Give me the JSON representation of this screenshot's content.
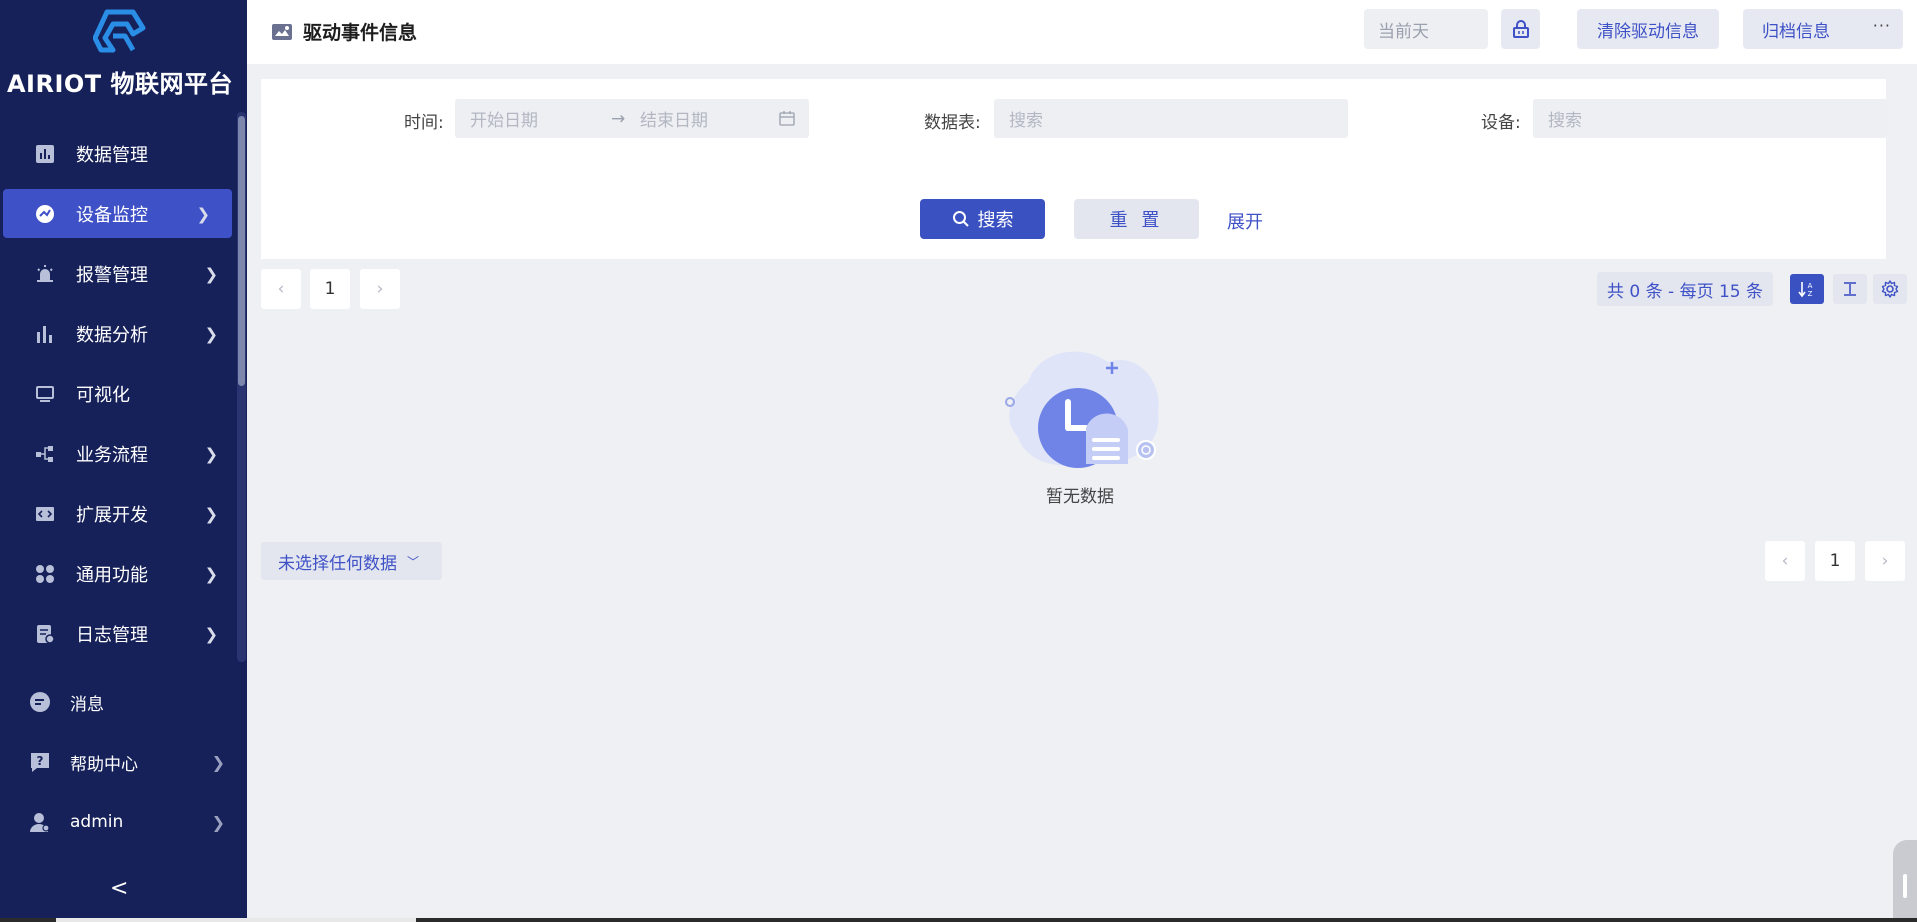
{
  "brand": {
    "name": "AIRIOT 物联网平台"
  },
  "sidebar": {
    "items": [
      {
        "label": "数据管理",
        "icon": "data-management-icon",
        "has_children": false
      },
      {
        "label": "设备监控",
        "icon": "device-monitor-icon",
        "has_children": true,
        "active": true
      },
      {
        "label": "报警管理",
        "icon": "alarm-icon",
        "has_children": true
      },
      {
        "label": "数据分析",
        "icon": "bar-chart-icon",
        "has_children": true
      },
      {
        "label": "可视化",
        "icon": "monitor-icon",
        "has_children": false
      },
      {
        "label": "业务流程",
        "icon": "flow-icon",
        "has_children": true
      },
      {
        "label": "扩展开发",
        "icon": "code-icon",
        "has_children": true
      },
      {
        "label": "通用功能",
        "icon": "apps-icon",
        "has_children": true
      },
      {
        "label": "日志管理",
        "icon": "log-icon",
        "has_children": true
      }
    ],
    "bottom": [
      {
        "label": "消息",
        "icon": "message-icon"
      },
      {
        "label": "帮助中心",
        "icon": "help-icon"
      },
      {
        "label": "admin",
        "icon": "user-icon"
      }
    ],
    "collapse_glyph": "<"
  },
  "header": {
    "title": "驱动事件信息",
    "current_day_placeholder": "当前天",
    "clear_label": "清除驱动信息",
    "archive_label": "归档信息",
    "more_glyph": "···"
  },
  "filters": {
    "time_label": "时间:",
    "start_placeholder": "开始日期",
    "end_placeholder": "结束日期",
    "table_label": "数据表:",
    "table_placeholder": "搜索",
    "device_label": "设备:",
    "device_placeholder": "搜索",
    "search_label": "搜索",
    "reset_label": "重 置",
    "expand_label": "展开"
  },
  "pagination": {
    "current_page": "1",
    "total_text": "共 0 条 - 每页 15 条"
  },
  "empty_state": {
    "text": "暂无数据"
  },
  "selection": {
    "label": "未选择任何数据"
  },
  "colors": {
    "sidebar_bg": "#16215a",
    "accent": "#3a51c2",
    "page_bg": "#eef0f4"
  }
}
